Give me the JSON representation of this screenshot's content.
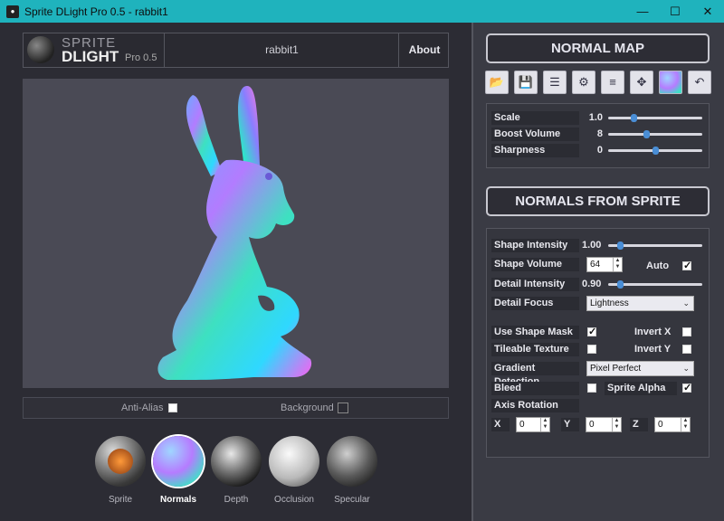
{
  "window": {
    "title": "Sprite DLight Pro 0.5 - rabbit1",
    "min": "—",
    "max": "☐",
    "close": "✕"
  },
  "header": {
    "logo_line1": "SPRITE",
    "logo_line2": "DLIGHT",
    "logo_version": "Pro 0.5",
    "filename": "rabbit1",
    "about_label": "About"
  },
  "options": {
    "anti_alias_label": "Anti-Alias",
    "anti_alias_checked": false,
    "background_label": "Background",
    "background_checked": false
  },
  "thumbnails": [
    {
      "label": "Sprite",
      "active": false
    },
    {
      "label": "Normals",
      "active": true
    },
    {
      "label": "Depth",
      "active": false
    },
    {
      "label": "Occlusion",
      "active": false
    },
    {
      "label": "Specular",
      "active": false
    }
  ],
  "normal_map": {
    "title": "NORMAL MAP",
    "toolbar": [
      "open-folder-icon",
      "save-icon",
      "sliders-icon",
      "gear-icon",
      "layers-icon",
      "directional-pad-icon",
      "normal-sphere-icon",
      "undo-icon"
    ],
    "params": [
      {
        "label": "Scale",
        "value": "1.0",
        "pos": 0.26
      },
      {
        "label": "Boost Volume",
        "value": "8",
        "pos": 0.4
      },
      {
        "label": "Sharpness",
        "value": "0",
        "pos": 0.5
      }
    ]
  },
  "normals_from_sprite": {
    "title": "NORMALS FROM SPRITE",
    "shape_intensity": {
      "label": "Shape Intensity",
      "value": "1.00",
      "pos": 0.1
    },
    "shape_volume": {
      "label": "Shape Volume",
      "value": "64"
    },
    "auto": {
      "label": "Auto",
      "checked": true
    },
    "detail_intensity": {
      "label": "Detail Intensity",
      "value": "0.90",
      "pos": 0.1
    },
    "detail_focus": {
      "label": "Detail Focus",
      "value": "Lightness"
    },
    "use_shape_mask": {
      "label": "Use Shape Mask",
      "checked": true
    },
    "invert_x": {
      "label": "Invert X",
      "checked": false
    },
    "tileable_texture": {
      "label": "Tileable Texture",
      "checked": false
    },
    "invert_y": {
      "label": "Invert Y",
      "checked": false
    },
    "gradient_detection": {
      "label": "Gradient Detection",
      "value": "Pixel Perfect"
    },
    "bleed": {
      "label": "Bleed",
      "checked": false
    },
    "sprite_alpha": {
      "label": "Sprite Alpha",
      "checked": true
    },
    "axis_rotation": {
      "label": "Axis Rotation",
      "x_label": "X",
      "x_value": "0",
      "y_label": "Y",
      "y_value": "0",
      "z_label": "Z",
      "z_value": "0"
    }
  }
}
